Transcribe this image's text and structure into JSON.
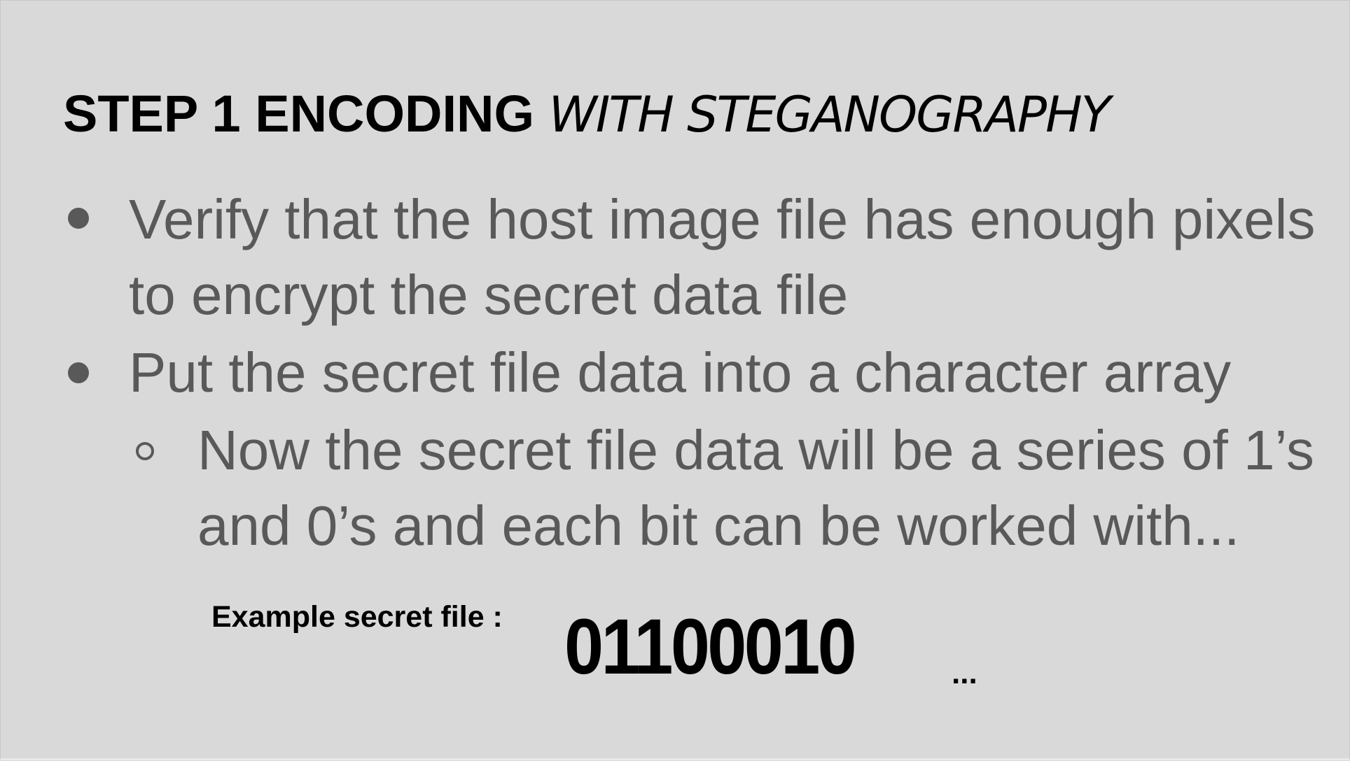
{
  "slide": {
    "title_bold": "STEP 1 ENCODING",
    "title_italic": "WITH STEGANOGRAPHY",
    "bullets": [
      {
        "lines": [
          "Verify that the host image file has enough pixels",
          "to encrypt the secret data file"
        ]
      },
      {
        "lines": [
          "Put the secret file data into a character array"
        ]
      }
    ],
    "sub_bullet": {
      "lines": [
        "Now the secret file data will be a series of 1’s",
        "and 0’s and each bit can be worked with..."
      ]
    },
    "example_label": "Example secret file :",
    "example_bits": "01100010",
    "ellipsis": "..."
  }
}
